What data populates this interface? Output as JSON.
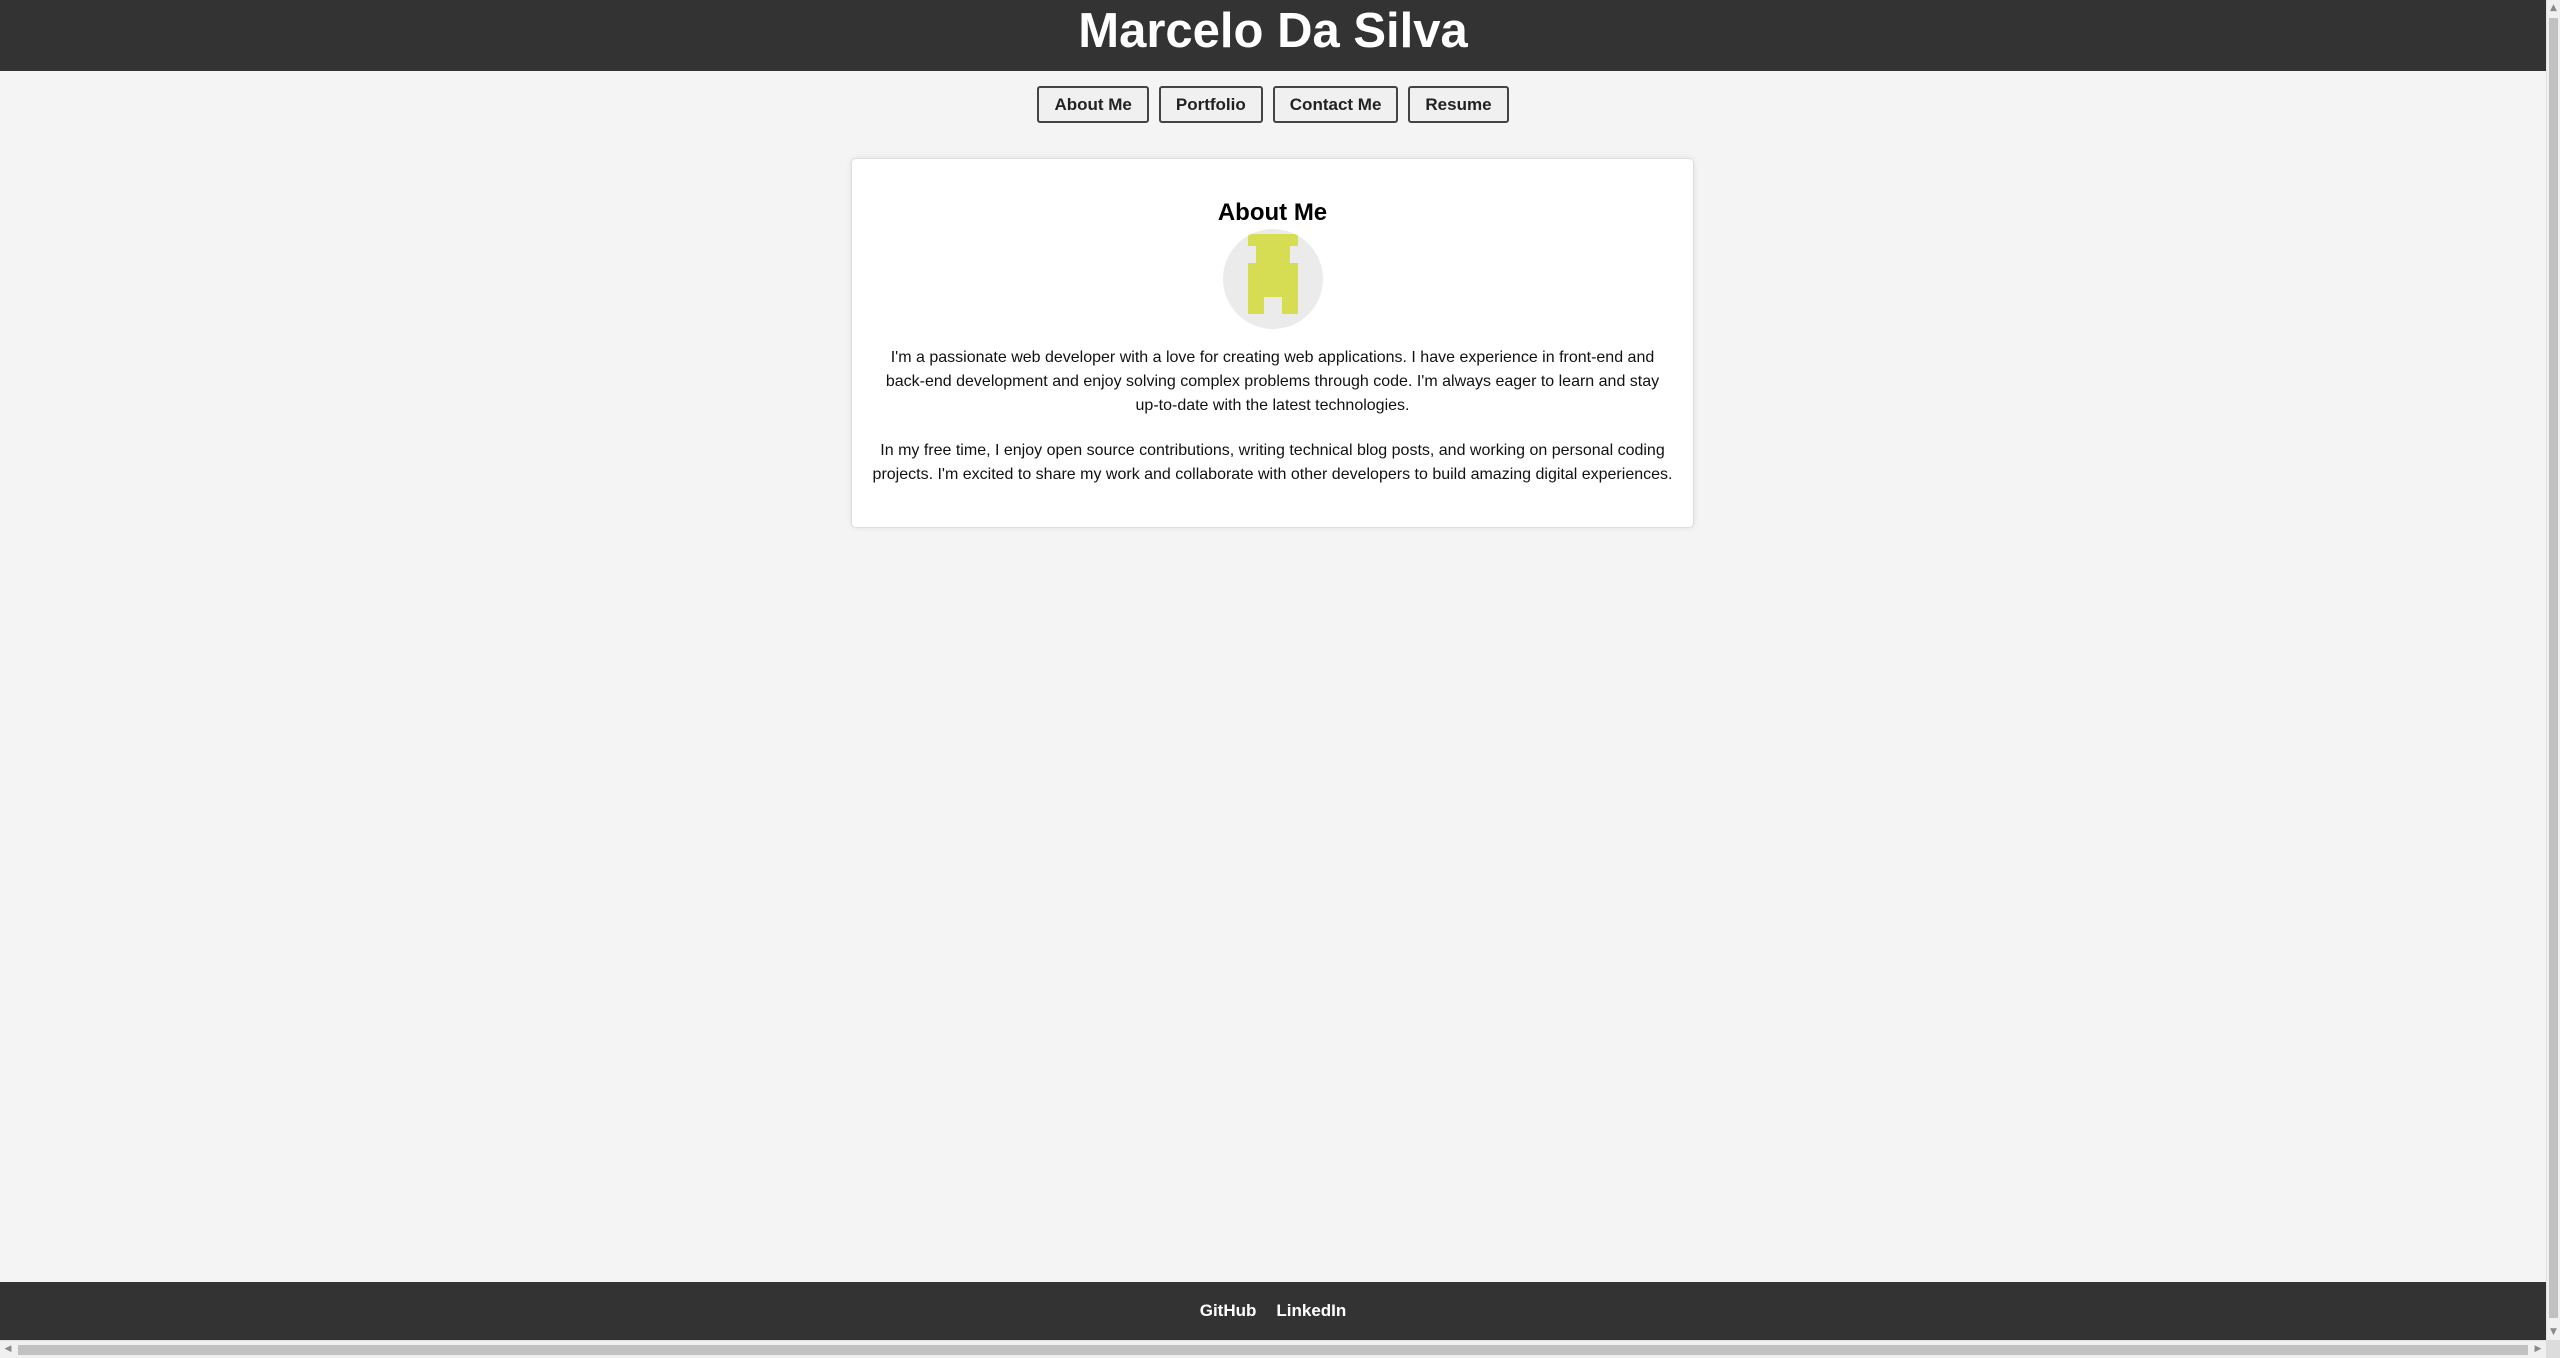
{
  "header": {
    "title": "Marcelo Da Silva"
  },
  "nav": {
    "items": [
      {
        "label": "About Me"
      },
      {
        "label": "Portfolio"
      },
      {
        "label": "Contact Me"
      },
      {
        "label": "Resume"
      }
    ]
  },
  "about": {
    "title": "About Me",
    "avatar_icon": "identicon-avatar",
    "avatar_color": "#d6dd53",
    "paragraphs": [
      "I'm a passionate web developer with a love for creating web applications. I have experience in front-end and back-end development and enjoy solving complex problems through code. I'm always eager to learn and stay up-to-date with the latest technologies.",
      "In my free time, I enjoy open source contributions, writing technical blog posts, and working on personal coding projects. I'm excited to share my work and collaborate with other developers to build amazing digital experiences."
    ]
  },
  "footer": {
    "links": [
      {
        "label": "GitHub"
      },
      {
        "label": "LinkedIn"
      }
    ]
  },
  "colors": {
    "header_bg": "#333333",
    "page_bg": "#f4f4f4",
    "card_bg": "#ffffff"
  }
}
